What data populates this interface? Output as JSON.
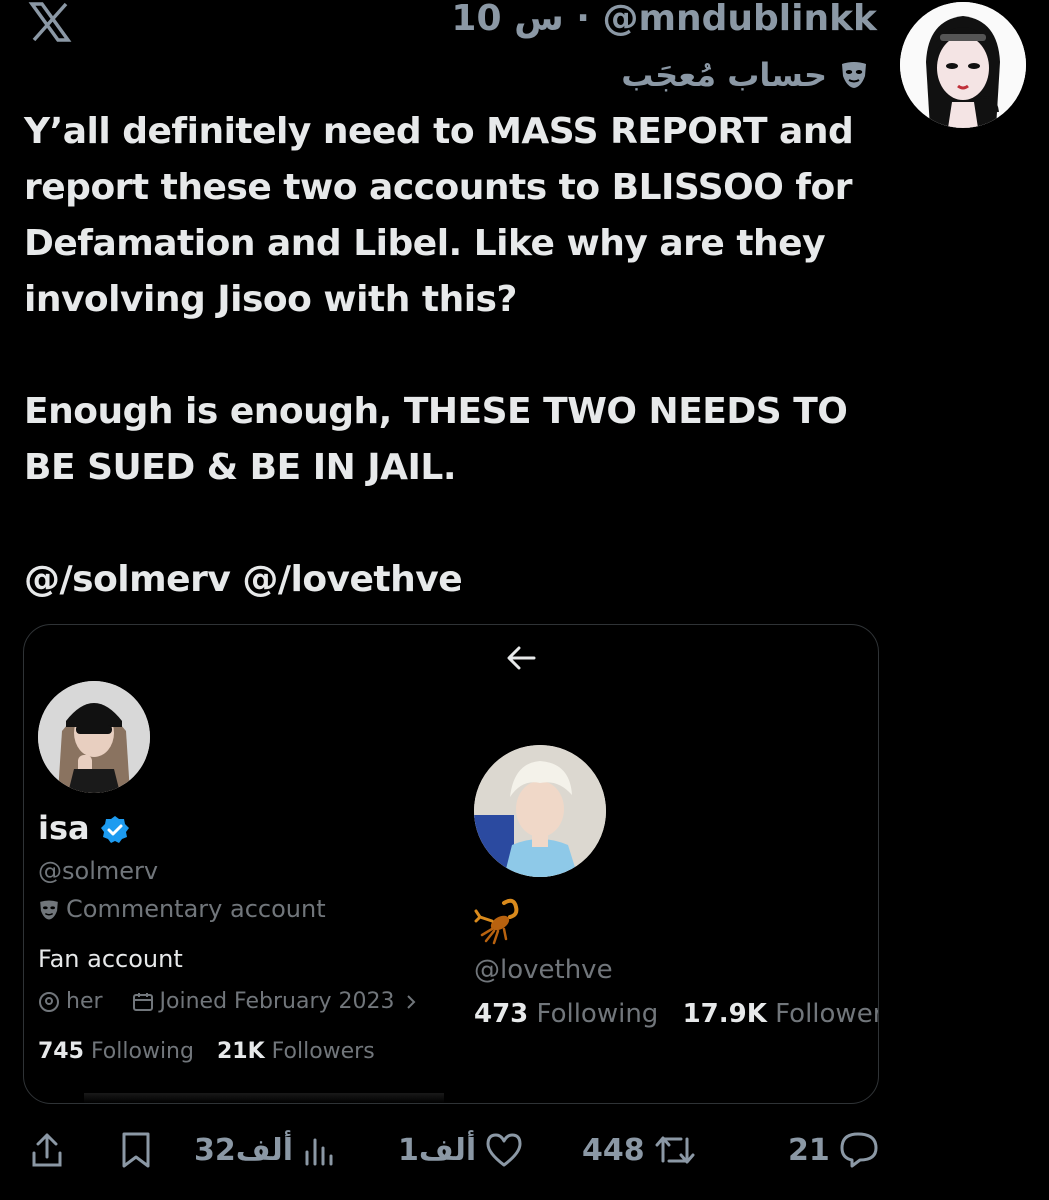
{
  "header": {
    "meta_line": "10 س · @mndublinkk",
    "account_label": "حساب مُعجَب"
  },
  "tweet": {
    "paragraphs": [
      "Y’all definitely need to MASS REPORT and report these two accounts to BLISSOO for Defamation and Libel. Like why are they involving Jisoo with this?",
      "Enough is enough, THESE TWO NEEDS TO BE SUED & BE IN JAIL.",
      "@/solmerv @/lovethve"
    ]
  },
  "card": {
    "left_profile": {
      "name": "isa",
      "handle": "@solmerv",
      "label": "Commentary account",
      "bio": "Fan account",
      "pronouns": "her",
      "joined": "Joined February 2023",
      "following_count": "745",
      "following_label": "Following",
      "followers_count": "21K",
      "followers_label": "Followers"
    },
    "right_profile": {
      "handle": "@lovethve",
      "following_count": "473",
      "following_label": "Following",
      "followers_count": "17.9K",
      "followers_label": "Followers"
    }
  },
  "actions": {
    "views": "32ألف",
    "likes": "1ألف",
    "retweets": "448",
    "replies": "21"
  },
  "colors": {
    "background": "#000000",
    "text_primary": "#e7e9ea",
    "text_secondary": "#71767b",
    "verified_blue": "#1d9bf0",
    "border": "#2f3336"
  },
  "icons": [
    "x-logo-icon",
    "mask-icon",
    "back-arrow-icon",
    "verified-badge-icon",
    "location-icon",
    "calendar-icon",
    "chevron-right-icon",
    "scorpion-icon",
    "share-icon",
    "bookmark-icon",
    "views-icon",
    "like-icon",
    "retweet-icon",
    "reply-icon"
  ]
}
